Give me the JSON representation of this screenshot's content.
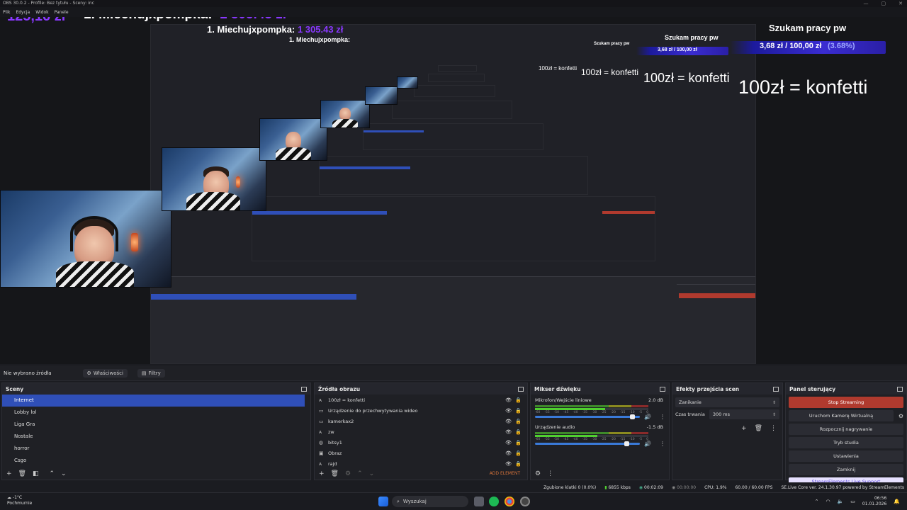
{
  "window": {
    "title": "OBS 30.0.2 - Profile: Bez tytułu - Sceny: inc",
    "controls": [
      "—",
      "▢",
      "✕"
    ]
  },
  "menu": [
    "Plik",
    "Edycja",
    "Widok",
    "Panele"
  ],
  "overlay": {
    "top_donor_amount": "125,16 zł",
    "top_donor_label": "1. Miechujxpompka:",
    "top_donor_value": "1 305.43 zł",
    "top_donor_label_small": "1. Miechujxpompka:",
    "top_donor_value_small": "1 305.43 zł",
    "top_donor_label_xs": "1. Miechujxpompka:",
    "goal_title": "Szukam pracy pw",
    "goal_value": "3,68 zł / 100,00 zł",
    "goal_percent": "(3.68%)",
    "goal_fraction": 0.0368,
    "confetti_text": "100zł = konfetti"
  },
  "source_toolbar": {
    "no_source": "Nie wybrano źródła",
    "properties": "Właściwości",
    "filters": "Filtry"
  },
  "scenes": {
    "title": "Sceny",
    "items": [
      "Internet",
      "Lobby lol",
      "Liga Gra",
      "Nostale",
      "horror",
      "Csgo"
    ],
    "active_index": 0
  },
  "sources": {
    "title": "Źródła obrazu",
    "items": [
      {
        "icon": "text-icon",
        "label": "100zł = konfetti",
        "glyph": "ᴀ"
      },
      {
        "icon": "capture-device-icon",
        "label": "Urządzenie do przechwytywania wideo",
        "glyph": "▭"
      },
      {
        "icon": "camera-icon",
        "label": "kamerkax2",
        "glyph": "▭"
      },
      {
        "icon": "text-icon",
        "label": "zw",
        "glyph": "ᴀ"
      },
      {
        "icon": "browser-icon",
        "label": "bitsy1",
        "glyph": "◍"
      },
      {
        "icon": "image-icon",
        "label": "Obraz",
        "glyph": "▣"
      },
      {
        "icon": "text-icon",
        "label": "rajd",
        "glyph": "ᴀ"
      }
    ],
    "add_element": "ADD ELEMENT"
  },
  "mixer": {
    "title": "Mikser dźwięku",
    "channels": [
      {
        "name": "Mikrofon/Wejście liniowe",
        "db": "2.0 dB",
        "level": 0.62,
        "volume": 0.95
      },
      {
        "name": "Urządzenie audio",
        "db": "-1.5 dB",
        "level": 0.55,
        "volume": 0.9
      }
    ],
    "ticks": [
      "-60",
      "-55",
      "-50",
      "-45",
      "-40",
      "-35",
      "-30",
      "-25",
      "-20",
      "-15",
      "-10",
      "-5",
      "0"
    ]
  },
  "transitions": {
    "title": "Efekty przejścia scen",
    "selected": "Zanikanie",
    "duration_label": "Czas trwania",
    "duration_value": "300 ms"
  },
  "controls": {
    "title": "Panel sterujący",
    "stop_streaming": "Stop Streaming",
    "virtual_cam": "Uruchom Kamerę Wirtualną",
    "record": "Rozpocznij nagrywanie",
    "studio": "Tryb studia",
    "settings": "Ustawienia",
    "exit": "Zamknij",
    "streamelements": "StreamElements Live Support"
  },
  "status": {
    "dropped": "Zgubione klatki 0 (0.0%)",
    "bitrate": "6855 kbps",
    "live_time": "00:02:09",
    "rec_time": "00:00:00",
    "cpu": "CPU: 1.9%",
    "fps": "60.00 / 60.00 FPS",
    "version": "SE.Live Core ver. 24.1.30.97 powered by StreamElements"
  },
  "taskbar": {
    "weather_temp": "-1°C",
    "weather_desc": "Pochmurnie",
    "search": "Wyszukaj",
    "time": "06:56",
    "date": "01.01.2026"
  },
  "colors": {
    "accent": "#2f4fb8",
    "stop": "#b03a2e",
    "donor_purple": "#8a38ff",
    "goal_bar": "#3a2cd1"
  }
}
